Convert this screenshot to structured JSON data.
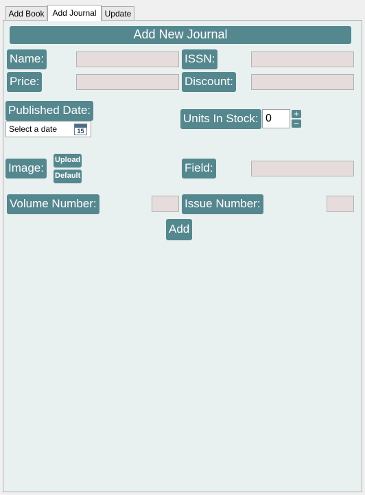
{
  "tabs": [
    {
      "label": "Add Book"
    },
    {
      "label": "Add Journal"
    },
    {
      "label": "Update"
    }
  ],
  "form": {
    "title": "Add New Journal",
    "name_label": "Name:",
    "issn_label": "ISSN:",
    "price_label": "Price:",
    "discount_label": "Discount:",
    "published_label": "Published Date:",
    "date_placeholder": "Select a date",
    "calendar_day": "15",
    "units_label": "Units In Stock:",
    "units_value": "0",
    "spin_up": "+",
    "spin_down": "−",
    "image_label": "Image:",
    "upload_label": "Upload",
    "default_label": "Default",
    "field_label": "Field:",
    "volume_label": "Volume Number:",
    "issue_label": "Issue Number:",
    "add_label": "Add"
  },
  "colors": {
    "accent": "#55878f",
    "panel_bg": "#e8f1f0",
    "field_bg": "#e6dcdc"
  }
}
